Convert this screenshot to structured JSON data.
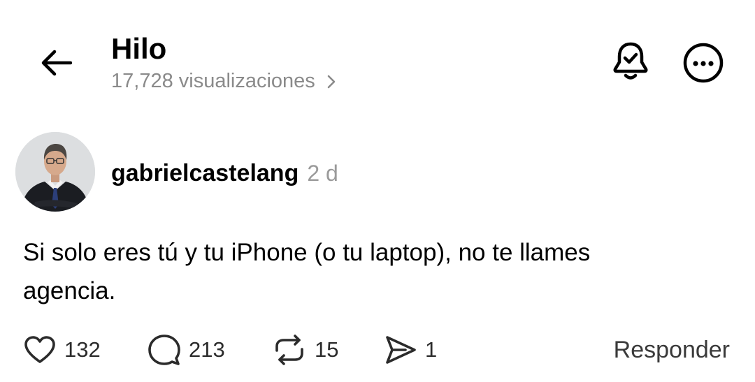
{
  "header": {
    "title": "Hilo",
    "views": "17,728 visualizaciones"
  },
  "post": {
    "username": "gabrielcastelang",
    "time": "2 d",
    "text_line1": "Si solo eres tú y tu iPhone (o tu laptop), no te llames",
    "text_line2": "agencia."
  },
  "actions": {
    "likes": "132",
    "comments": "213",
    "reposts": "15",
    "shares": "1",
    "reply_label": "Responder"
  },
  "icons": {
    "back": "arrow-left-icon",
    "views_chevron": "chevron-right-icon",
    "notifications": "bell-check-icon",
    "more": "more-horizontal-icon",
    "like": "heart-icon",
    "comment": "comment-icon",
    "repost": "repost-icon",
    "share": "send-icon"
  },
  "colors": {
    "text": "#000000",
    "muted": "#8a8a8a",
    "action": "#2b2b2b",
    "background": "#ffffff"
  }
}
